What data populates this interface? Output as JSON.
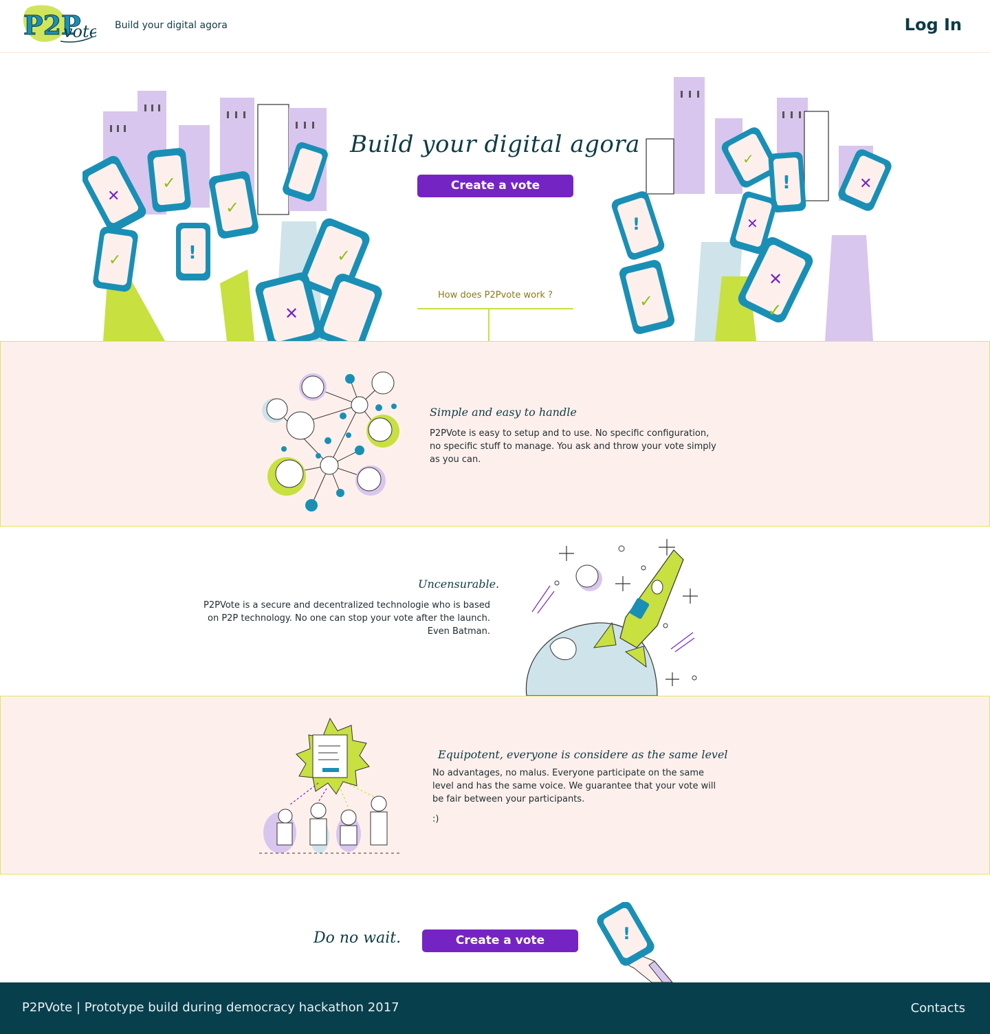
{
  "header": {
    "logo_text": "P2Pvote!",
    "tagline": "Build your digital agora",
    "login_label": "Log In"
  },
  "hero": {
    "title": "Build your digital agora",
    "cta_label": "Create a vote",
    "how_link": "How does P2Pvote work ?"
  },
  "features": [
    {
      "title": "Simple and easy to handle",
      "text": "P2PVote is easy to setup and to use. No specific configuration, no specific stuff to manage. You ask and throw your vote simply as you can."
    },
    {
      "title": "Uncensurable.",
      "text": "P2PVote is a secure and decentralized technologie who is based on P2P technology. No one can stop your vote after the launch. Even Batman."
    },
    {
      "title": "Equipotent, everyone is considere as the same level",
      "text": "No advantages, no malus. Everyone participate on the same level and has the same voice. We guarantee that your vote will be fair between your participants.",
      "smiley": ":)"
    }
  ],
  "bottom_cta": {
    "text": "Do no wait.",
    "button_label": "Create a vote"
  },
  "footer": {
    "left_text": "P2PVote | Prototype build during democracy hackathon 2017",
    "contacts_label": "Contacts"
  },
  "colors": {
    "primary": "#7524c4",
    "navy": "#083f4d",
    "band_bg": "#fdf0ec",
    "lime": "#c8e040",
    "teal": "#1a8fb5",
    "lavender": "#d8c6ee"
  },
  "icons": [
    "logo-icon",
    "city-hands-left-illustration",
    "city-hands-right-illustration",
    "network-people-illustration",
    "rocket-planet-illustration",
    "voting-people-illustration",
    "hand-phone-illustration"
  ]
}
